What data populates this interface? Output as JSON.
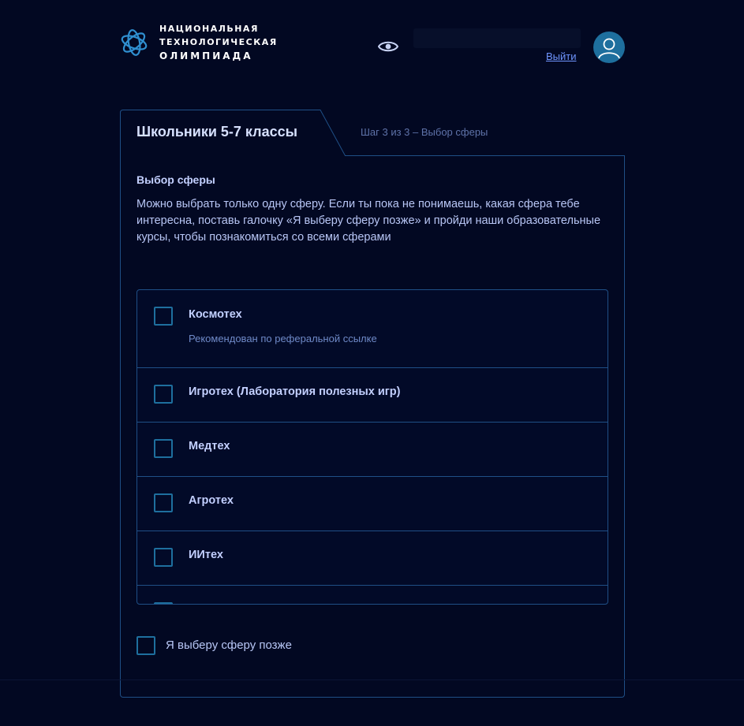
{
  "header": {
    "logo_line1": "НАЦИОНАЛЬНАЯ",
    "logo_line2": "ТЕХНОЛОГИЧЕСКАЯ",
    "logo_line3": "ОЛИМПИАДА",
    "logout_label": "Выйти"
  },
  "card": {
    "tab_title": "Школьники 5-7 классы",
    "step_label": "Шаг 3 из 3 – Выбор сферы",
    "section_title": "Выбор сферы",
    "description": "Можно выбрать только одну сферу. Если ты пока не понимаешь, какая сфера тебе интересна, поставь галочку «Я выберу сферу позже» и пройди наши образовательные курсы, чтобы познакомиться со всеми сферами"
  },
  "spheres": [
    {
      "label": "Космотех",
      "sub": "Рекомендован по реферальной ссылке",
      "checked": false
    },
    {
      "label": "Игротех (Лаборатория полезных игр)",
      "checked": false
    },
    {
      "label": "Медтех",
      "checked": false
    },
    {
      "label": "Агротех",
      "checked": false
    },
    {
      "label": "ИИтех",
      "checked": false
    }
  ],
  "choose_later": {
    "label": "Я выберу сферу позже",
    "checked": false
  },
  "colors": {
    "background": "#020822",
    "border": "#1f4f86",
    "checkbox": "#1e6f9e",
    "link": "#6f95ff"
  }
}
